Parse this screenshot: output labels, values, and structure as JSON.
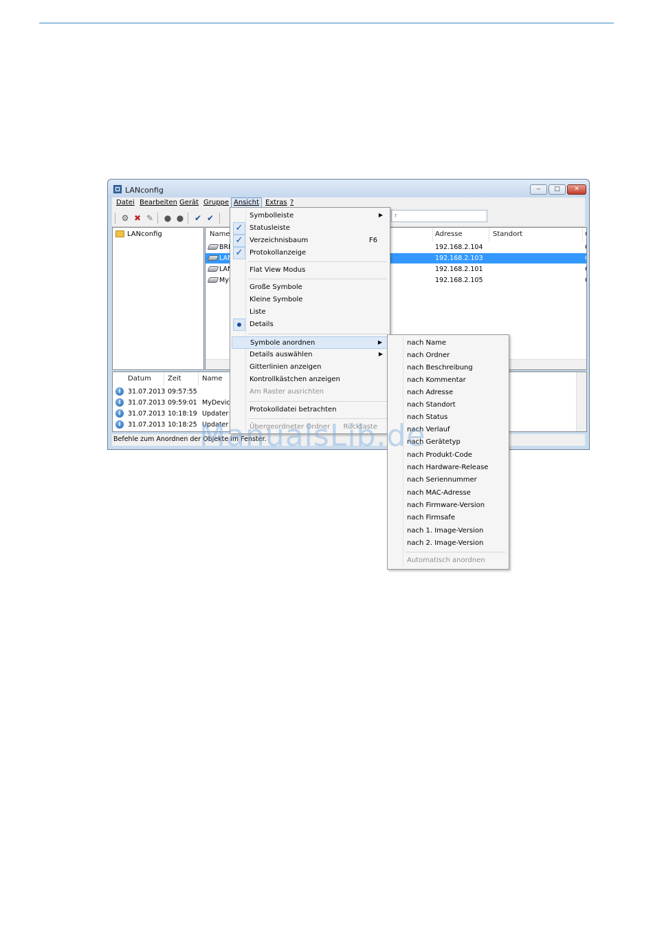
{
  "window": {
    "title": "LANconfig",
    "minimize": "‒",
    "maximize": "□",
    "close": "✕"
  },
  "menubar": {
    "items": [
      "Datei",
      "Bearbeiten",
      "Gerät",
      "Gruppe",
      "Ansicht",
      "Extras",
      "?"
    ],
    "active": "Ansicht"
  },
  "toolbar": {
    "search_placeholder": "r"
  },
  "tree": {
    "root": "LANconfig"
  },
  "list": {
    "columns": [
      "Name",
      "Adresse",
      "Standort",
      "C"
    ],
    "rows": [
      {
        "name": "BRI-",
        "address": "192.168.2.104",
        "extra": "C"
      },
      {
        "name": "LAN",
        "address": "192.168.2.103",
        "extra": "C",
        "selected": true
      },
      {
        "name": "LAN",
        "address": "192.168.2.101",
        "extra": "C"
      },
      {
        "name": "MyD",
        "address": "192.168.2.105",
        "extra": "C"
      }
    ]
  },
  "log": {
    "columns": [
      "Datum",
      "Zeit",
      "Name"
    ],
    "rows": [
      {
        "date": "31.07.2013",
        "time": "09:57:55",
        "name": ""
      },
      {
        "date": "31.07.2013",
        "time": "09:59:01",
        "name": "MyDevice"
      },
      {
        "date": "31.07.2013",
        "time": "10:18:19",
        "name": "Updater"
      },
      {
        "date": "31.07.2013",
        "time": "10:18:25",
        "name": "Updater"
      }
    ]
  },
  "statusbar": {
    "text": "Befehle zum Anordnen der Objekte im Fenster."
  },
  "ansicht_menu": {
    "items": [
      {
        "label": "Symbolleiste",
        "submenu": true
      },
      {
        "label": "Statusleiste",
        "checked": true
      },
      {
        "label": "Verzeichnisbaum",
        "checked": true,
        "shortcut": "F6"
      },
      {
        "label": "Protokollanzeige",
        "checked": true
      },
      {
        "label": "Flat View Modus"
      },
      {
        "label": "Große Symbole"
      },
      {
        "label": "Kleine Symbole"
      },
      {
        "label": "Liste"
      },
      {
        "label": "Details",
        "radio": true
      },
      {
        "label": "Symbole anordnen",
        "submenu": true,
        "highlighted": true
      },
      {
        "label": "Details auswählen",
        "submenu": true
      },
      {
        "label": "Gitterlinien anzeigen"
      },
      {
        "label": "Kontrollkästchen anzeigen"
      },
      {
        "label": "Am Raster ausrichten",
        "disabled": true
      },
      {
        "label": "Protokolldatei betrachten"
      },
      {
        "label": "Übergeordneter Ordner",
        "disabled": true,
        "shortcut": "Rücktaste"
      }
    ]
  },
  "symbole_anordnen_submenu": {
    "items": [
      "nach Name",
      "nach Ordner",
      "nach Beschreibung",
      "nach Kommentar",
      "nach Adresse",
      "nach Standort",
      "nach Status",
      "nach Verlauf",
      "nach Gerätetyp",
      "nach Produkt-Code",
      "nach Hardware-Release",
      "nach Seriennummer",
      "nach MAC-Adresse",
      "nach Firmware-Version",
      "nach Firmsafe",
      "nach 1. Image-Version",
      "nach 2. Image-Version"
    ],
    "disabled_item": "Automatisch anordnen"
  },
  "watermark": "ManualsLib.de",
  "colors": {
    "accent_line": "#2e86c8",
    "selection": "#3399ff",
    "menu_highlight": "#dde9f7"
  }
}
